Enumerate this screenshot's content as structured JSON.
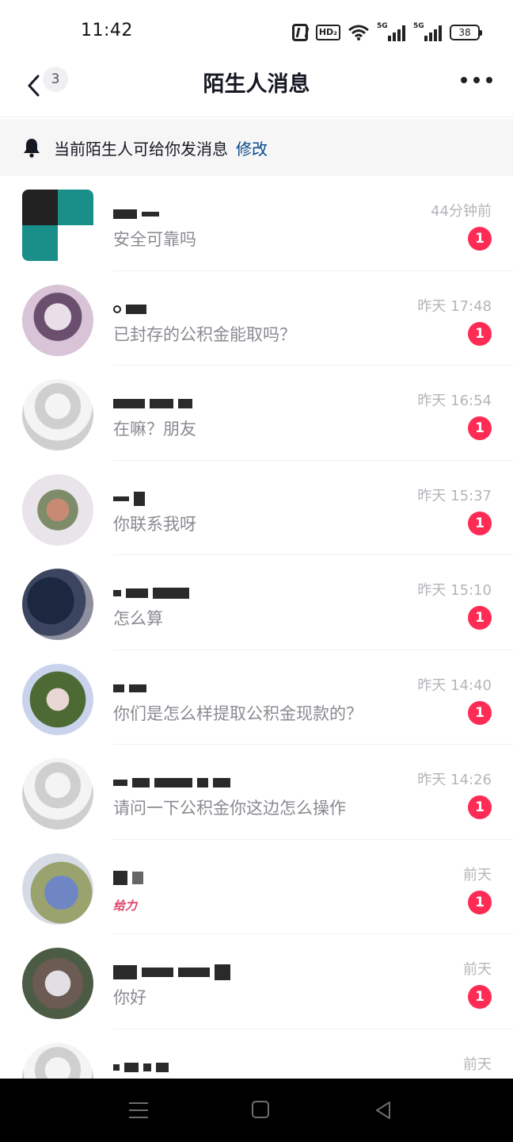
{
  "status_bar": {
    "time": "11:42",
    "network_1": "5G",
    "network_2": "5G",
    "battery": "38",
    "hd_label": "HD₂"
  },
  "nav": {
    "back_count": "3",
    "title": "陌生人消息"
  },
  "notice": {
    "text": "当前陌生人可给你发消息",
    "link": "修改"
  },
  "messages": [
    {
      "preview": "安全可靠吗",
      "time": "44分钟前",
      "unread": "1"
    },
    {
      "preview": "已封存的公积金能取吗？",
      "time": "昨天 17:48",
      "unread": "1"
    },
    {
      "preview": "在嘛？朋友",
      "time": "昨天 16:54",
      "unread": "1"
    },
    {
      "preview": "你联系我呀",
      "time": "昨天 15:37",
      "unread": "1"
    },
    {
      "preview": "怎么算",
      "time": "昨天 15:10",
      "unread": "1"
    },
    {
      "preview": "你们是怎么样提取公积金现款的？",
      "time": "昨天 14:40",
      "unread": "1"
    },
    {
      "preview": "请问一下公积金你这边怎么操作",
      "time": "昨天 14:26",
      "unread": "1"
    },
    {
      "preview": "给力",
      "time": "前天",
      "unread": "1"
    },
    {
      "preview": "你好",
      "time": "前天",
      "unread": "1"
    },
    {
      "preview": "",
      "time": "前天",
      "unread": ""
    }
  ],
  "colors": {
    "accent_link": "#04498d",
    "badge": "#fe2c55",
    "muted_text": "#8a8b91",
    "time_text": "#b4b5b9"
  }
}
